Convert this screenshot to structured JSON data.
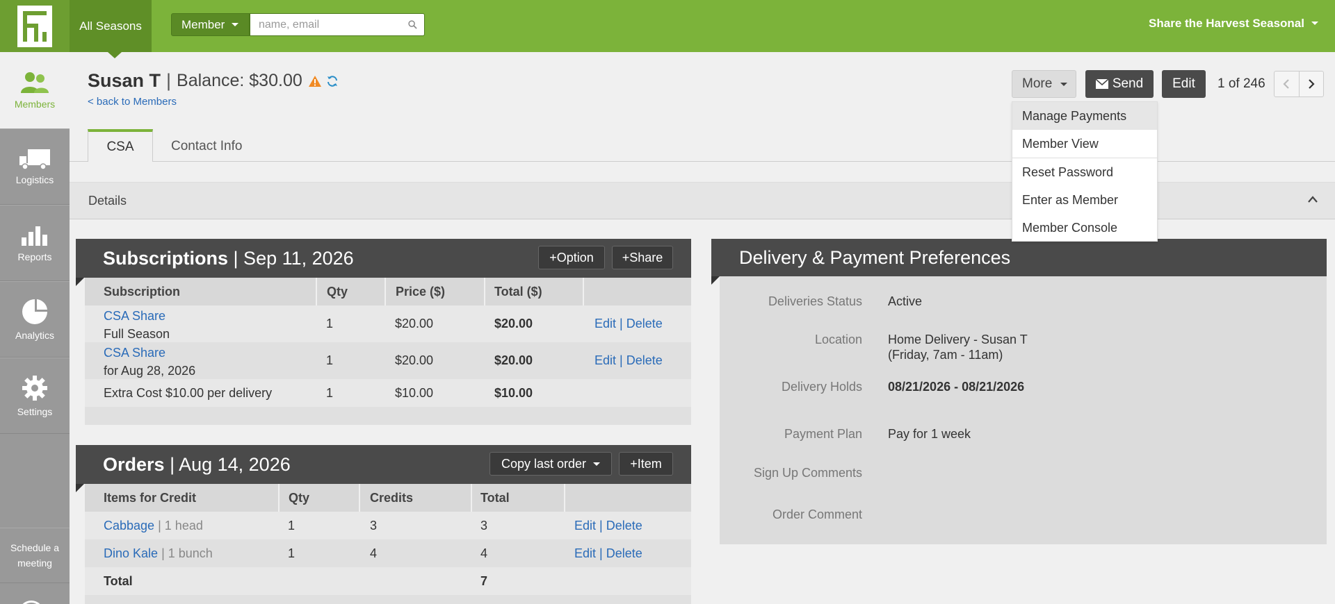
{
  "topbar": {
    "season_label": "All Seasons",
    "member_select": "Member",
    "search_placeholder": "name, email",
    "account_name": "Share the Harvest Seasonal"
  },
  "sidebar": {
    "items": [
      {
        "label": "Members",
        "icon": "members-icon"
      },
      {
        "label": "Logistics",
        "icon": "truck-icon"
      },
      {
        "label": "Reports",
        "icon": "bar-chart-icon"
      },
      {
        "label": "Analytics",
        "icon": "pie-chart-icon"
      },
      {
        "label": "Settings",
        "icon": "gear-icon"
      }
    ],
    "meeting_label": "Schedule a meeting"
  },
  "header": {
    "member_name": "Susan T",
    "separator": "|",
    "balance": "Balance: $30.00",
    "back_link": "< back to Members",
    "more_label": "More",
    "send_label": "Send",
    "edit_label": "Edit",
    "pager_text": "1 of 246"
  },
  "more_menu": {
    "items": [
      "Manage Payments",
      "Member View",
      "Reset Password",
      "Enter as Member",
      "Member Console"
    ]
  },
  "tabs": [
    "CSA",
    "Contact Info"
  ],
  "details_label": "Details",
  "subscriptions": {
    "title": "Subscriptions",
    "date": "| Sep 11, 2026",
    "add_option": "+Option",
    "add_share": "+Share",
    "columns": [
      "Subscription",
      "Qty",
      "Price ($)",
      "Total ($)"
    ],
    "rows": [
      {
        "name": "CSA Share",
        "sub": "Full Season",
        "qty": "1",
        "price": "$20.00",
        "total": "$20.00",
        "edit": "Edit",
        "sep": "|",
        "delete": "Delete"
      },
      {
        "name": "CSA Share",
        "sub": "for Aug 28, 2026",
        "qty": "1",
        "price": "$20.00",
        "total": "$20.00",
        "edit": "Edit",
        "sep": "|",
        "delete": "Delete"
      },
      {
        "name": "Extra Cost $10.00 per delivery",
        "qty": "1",
        "price": "$10.00",
        "total": "$10.00"
      }
    ]
  },
  "orders": {
    "title": "Orders",
    "date": "| Aug 14, 2026",
    "copy_last": "Copy last order",
    "add_item": "+Item",
    "columns": [
      "Items for Credit",
      "Qty",
      "Credits",
      "Total"
    ],
    "rows": [
      {
        "name": "Cabbage",
        "sep": "|",
        "unit": "1 head",
        "qty": "1",
        "credits": "3",
        "total": "3",
        "edit": "Edit",
        "delete": "Delete"
      },
      {
        "name": "Dino Kale",
        "sep": "|",
        "unit": "1 bunch",
        "qty": "1",
        "credits": "4",
        "total": "4",
        "edit": "Edit",
        "delete": "Delete"
      }
    ],
    "total_label": "Total",
    "total_value": "7"
  },
  "preferences": {
    "title": "Delivery & Payment Preferences",
    "fields": [
      {
        "label": "Deliveries Status",
        "value": "Active"
      },
      {
        "label": "Location",
        "value": "Home Delivery - Susan T",
        "sub": "(Friday, 7am - 11am)"
      },
      {
        "label": "Delivery Holds",
        "value": "08/21/2026 - 08/21/2026"
      },
      {
        "label": "Payment Plan",
        "value": "Pay for 1 week"
      },
      {
        "label": "Sign Up Comments",
        "value": ""
      },
      {
        "label": "Order Comment",
        "value": ""
      }
    ]
  },
  "colors": {
    "brand_green": "#7cb33a",
    "dark_header": "#4a4a4a",
    "link_blue": "#2a6bb8",
    "warning_orange": "#f08a24"
  }
}
